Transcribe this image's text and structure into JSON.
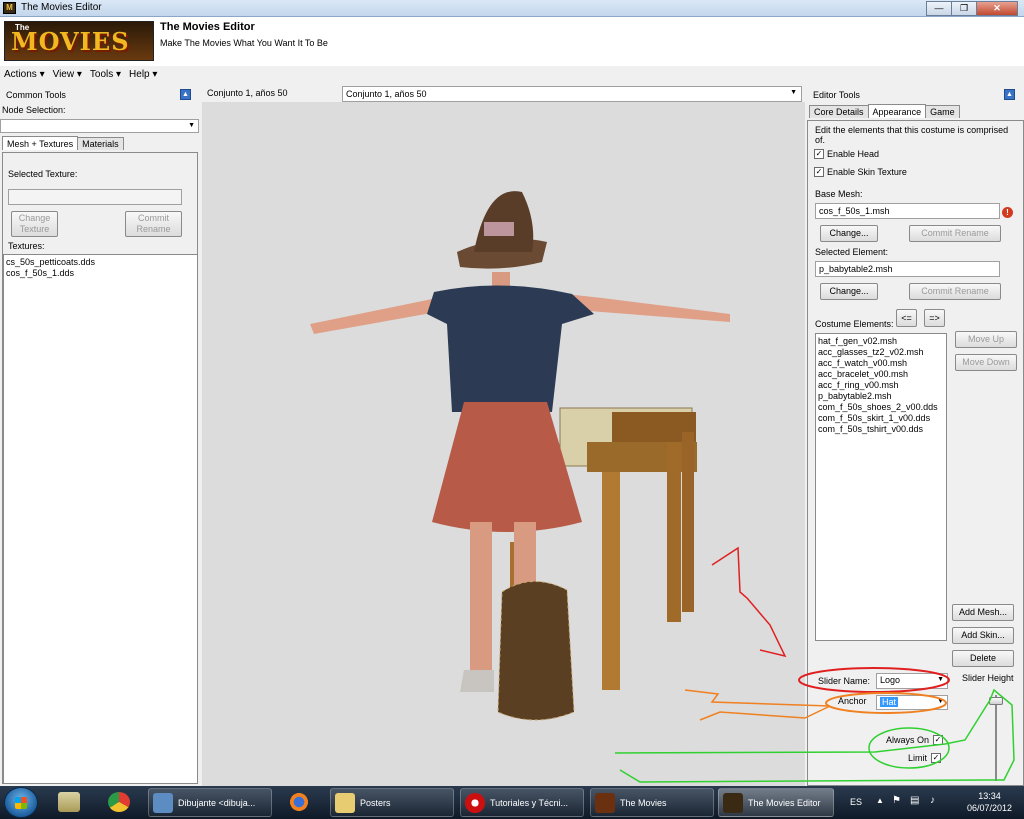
{
  "window": {
    "title": "The Movies Editor"
  },
  "header": {
    "logo_text": "MOVIES",
    "logo_small": "The",
    "title": "The Movies Editor",
    "subtitle": "Make The Movies What You Want It To Be"
  },
  "menu": [
    "Actions ▾",
    "View ▾",
    "Tools ▾",
    "Help ▾"
  ],
  "left": {
    "title": "Common Tools",
    "node_selection_label": "Node Selection:",
    "node_selection_value": "",
    "tabs": [
      "Mesh + Textures",
      "Materials"
    ],
    "selected_texture_label": "Selected Texture:",
    "selected_texture_value": "",
    "change_texture": "Change Texture",
    "commit_rename": "Commit Rename",
    "textures_label": "Textures:",
    "textures": [
      "cs_50s_petticoats.dds",
      "cos_f_50s_1.dds"
    ]
  },
  "viewport": {
    "breadcrumb": "Conjunto 1, años 50",
    "selector": "Conjunto 1, años 50"
  },
  "right": {
    "title": "Editor Tools",
    "tabs": [
      "Core Details",
      "Appearance",
      "Game"
    ],
    "description": "Edit the elements that this costume is comprised of.",
    "enable_head": "Enable Head",
    "enable_skin": "Enable Skin Texture",
    "base_mesh_label": "Base Mesh:",
    "base_mesh_value": "cos_f_50s_1.msh",
    "change": "Change...",
    "commit_rename": "Commit Rename",
    "selected_element_label": "Selected Element:",
    "selected_element_value": "p_babytable2.msh",
    "costume_elements_label": "Costume Elements:",
    "prev": "<=",
    "next": "=>",
    "move_up": "Move Up",
    "move_down": "Move Down",
    "elements": [
      "hat_f_gen_v02.msh",
      "acc_glasses_tz2_v02.msh",
      "acc_f_watch_v00.msh",
      "acc_bracelet_v00.msh",
      "acc_f_ring_v00.msh",
      "p_babytable2.msh",
      "com_f_50s_shoes_2_v00.dds",
      "com_f_50s_skirt_1_v00.dds",
      "com_f_50s_tshirt_v00.dds"
    ],
    "add_mesh": "Add Mesh...",
    "add_skin": "Add Skin...",
    "delete": "Delete",
    "slider_name_label": "Slider Name:",
    "slider_name_value": "Logo",
    "slider_height_label": "Slider Height",
    "anchor_label": "Anchor",
    "anchor_value": "Hat",
    "always_on": "Always On",
    "limit": "Limit"
  },
  "taskbar": {
    "items": [
      "Dibujante <dibuja...",
      "Posters",
      "Tutoriales y Técni...",
      "The Movies",
      "The Movies Editor"
    ],
    "lang": "ES",
    "time": "13:34",
    "date": "06/07/2012"
  },
  "icons": {
    "app": "movies-app-icon",
    "pin": "pin-icon",
    "error": "error-icon"
  }
}
